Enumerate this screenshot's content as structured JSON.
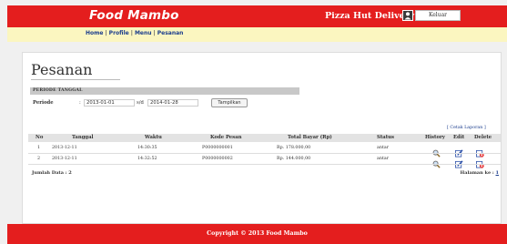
{
  "app": {
    "brand": "Food Mambo",
    "store_name": "Pizza Hut Delivery",
    "logout_label": "Keluar"
  },
  "nav": {
    "links": [
      "Home",
      "Profile",
      "Menu",
      "Pesanan"
    ],
    "separator": "|"
  },
  "page": {
    "title": "Pesanan",
    "section_header": "PERIODE TANGGAL",
    "period_label": "Periode",
    "colon": ":",
    "date_from": "2013-01-01",
    "until_label": "s/d",
    "date_to": "2014-01-28",
    "show_button": "Tampilkan",
    "print_link": "[ Cetak Laporan ]"
  },
  "table": {
    "headers": [
      "No",
      "Tanggal",
      "Waktu",
      "Kode Pesan",
      "Total Bayar (Rp)",
      "Status",
      "History",
      "Edit",
      "Delete"
    ],
    "rows": [
      {
        "no": "1",
        "tanggal": "2013-12-11",
        "waktu": "14:30:35",
        "kode": "P0000000001",
        "total": "Rp. 178.000,00",
        "status": "antar"
      },
      {
        "no": "2",
        "tanggal": "2013-12-11",
        "waktu": "14:32:52",
        "kode": "P0000000002",
        "total": "Rp. 144.000,00",
        "status": "antar"
      }
    ],
    "count_text": "Jumlah Data : 2",
    "page_text": "Halaman ke :",
    "page_number": "1"
  },
  "footer": {
    "copyright": "Copyright © 2013 Food Mambo"
  },
  "colors": {
    "brand_red": "#e41e1e",
    "nav_bg": "#fbf6c0",
    "link_blue": "#1a3c8c"
  },
  "icons": {
    "history": "magnifier-icon",
    "edit": "pencil-edit-icon",
    "delete": "delete-icon",
    "user": "user-icon"
  }
}
